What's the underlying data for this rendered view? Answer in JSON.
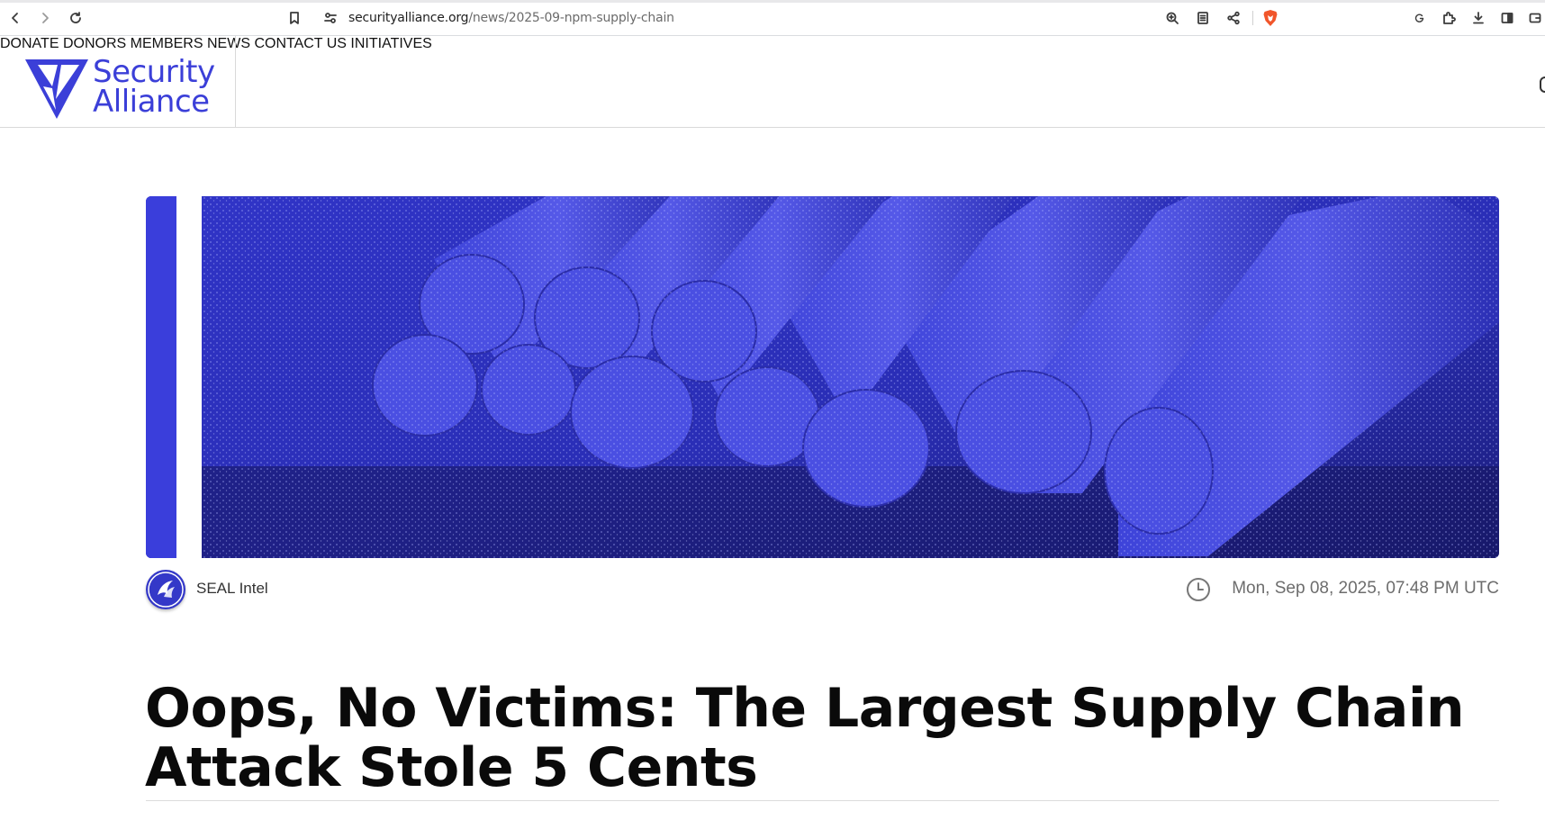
{
  "browser": {
    "url_domain": "securityalliance.org",
    "url_path": "/news/2025-09-npm-supply-chain",
    "icons": [
      "back-icon",
      "forward-icon",
      "reload-icon",
      "bookmark-icon",
      "site-info-icon",
      "zoom-icon",
      "reader-mode-icon",
      "share-icon",
      "brave-shields-icon",
      "translate-icon",
      "extensions-icon",
      "downloads-icon",
      "sidebar-icon",
      "wallet-icon"
    ]
  },
  "site": {
    "logo_line1": "Security",
    "logo_line2": "Alliance",
    "brand_color": "#3b3fd8"
  },
  "nav": {
    "items": [
      "DONATE",
      "DONORS",
      "MEMBERS",
      "NEWS",
      "CONTACT US",
      "INITIATIVES"
    ]
  },
  "article": {
    "author": "SEAL Intel",
    "date": "Mon, Sep 08, 2025, 07:48 PM UTC",
    "title": "Oops, No Victims: The Largest Supply Chain Attack Stole 5 Cents"
  }
}
